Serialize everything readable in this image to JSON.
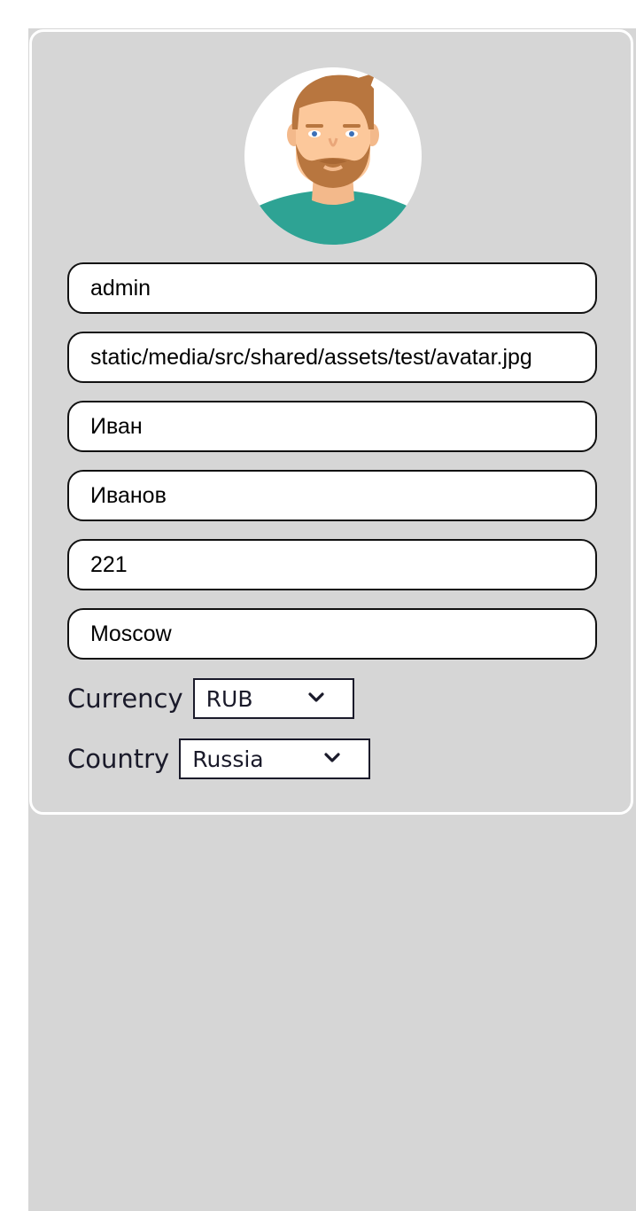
{
  "profile": {
    "avatar_alt": "avatar",
    "fields": {
      "username": "admin",
      "avatar_path": "static/media/src/shared/assets/test/avatar.jpg",
      "first_name": "Иван",
      "last_name": "Иванов",
      "age": "221",
      "city": "Moscow"
    },
    "currency": {
      "label": "Currency",
      "selected": "RUB"
    },
    "country": {
      "label": "Country",
      "selected": "Russia"
    }
  },
  "colors": {
    "background": "#d6d6d6",
    "card_border": "#ffffff",
    "input_border": "#111111",
    "text": "#1a1a2a"
  },
  "icons": {
    "dropdown": "chevron-down-icon"
  }
}
